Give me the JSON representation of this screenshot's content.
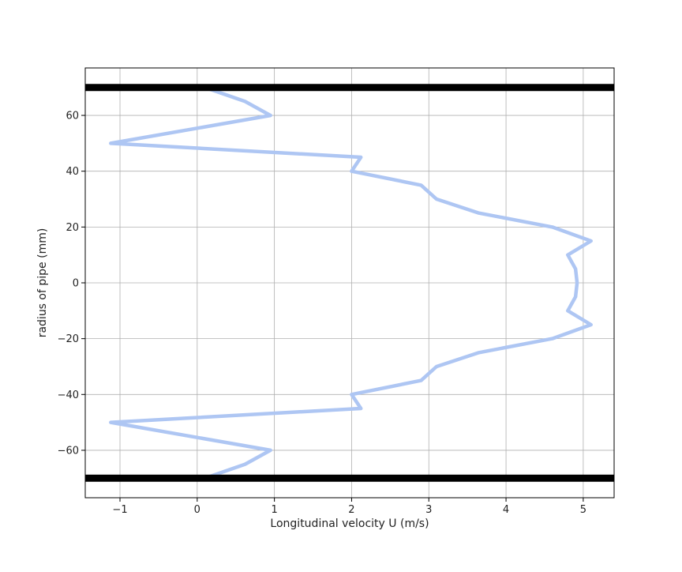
{
  "chart_data": {
    "type": "line",
    "title": "",
    "xlabel": "Longitudinal velocity U (m/s)",
    "ylabel": "radius of pipe (mm)",
    "xlim": [
      -1.45,
      5.4
    ],
    "ylim": [
      -77,
      77
    ],
    "xticks": [
      -1,
      0,
      1,
      2,
      3,
      4,
      5
    ],
    "xtick_labels": [
      "−1",
      "0",
      "1",
      "2",
      "3",
      "4",
      "5"
    ],
    "yticks": [
      -60,
      -40,
      -20,
      0,
      20,
      40,
      60
    ],
    "ytick_labels": [
      "−60",
      "−40",
      "−20",
      "0",
      "20",
      "40",
      "60"
    ],
    "grid": true,
    "series": [
      {
        "color": "#aec6f3",
        "x": [
          0.1,
          0.62,
          0.95,
          -1.12,
          2.12,
          2.0,
          2.9,
          3.1,
          3.65,
          4.6,
          5.1,
          4.8,
          4.9,
          4.92,
          4.9,
          4.8,
          5.1,
          4.6,
          3.65,
          3.1,
          2.9,
          2.0,
          2.12,
          -1.12,
          0.95,
          0.62,
          0.1
        ],
        "y": [
          70,
          65,
          60,
          50,
          45,
          40,
          35,
          30,
          25,
          20,
          15,
          10,
          5,
          0,
          -5,
          -10,
          -15,
          -20,
          -25,
          -30,
          -35,
          -40,
          -45,
          -50,
          -60,
          -65,
          -70
        ]
      }
    ],
    "annotations": [
      {
        "type": "hline",
        "y": 70,
        "color": "#000000"
      },
      {
        "type": "hline",
        "y": -70,
        "color": "#000000"
      }
    ]
  }
}
